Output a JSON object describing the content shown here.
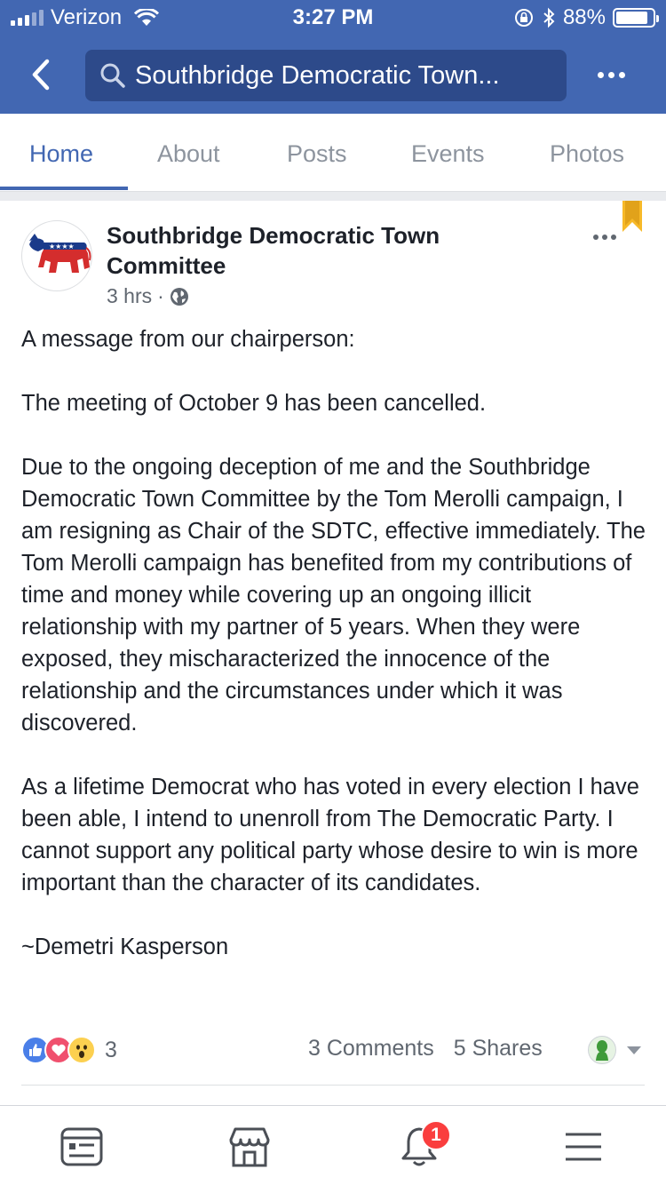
{
  "status_bar": {
    "carrier": "Verizon",
    "time": "3:27 PM",
    "battery": "88%",
    "battery_level": 0.88,
    "icons": [
      "signal-icon",
      "wifi-icon",
      "rotation-lock-icon",
      "bluetooth-icon",
      "battery-icon"
    ]
  },
  "header": {
    "search_text": "Southbridge Democratic Town...",
    "back_icon": "chevron-left-icon",
    "more_icon": "more-horizontal-icon"
  },
  "tabs": [
    {
      "label": "Home",
      "active": true
    },
    {
      "label": "About",
      "active": false
    },
    {
      "label": "Posts",
      "active": false
    },
    {
      "label": "Events",
      "active": false
    },
    {
      "label": "Photos",
      "active": false
    }
  ],
  "post": {
    "author": "Southbridge Democratic Town Committee",
    "time": "3 hrs",
    "visibility_icon": "globe-icon",
    "paragraphs": [
      "A message from our chairperson:",
      "The meeting of October 9 has been cancelled.",
      "Due to the ongoing deception of me and the Southbridge Democratic Town Committee by the Tom Merolli campaign, I am resigning as Chair of the SDTC, effective immediately. The Tom Merolli campaign has benefited from my contributions of time and money while covering up an ongoing illicit relationship with my partner of 5 years. When they were exposed, they mischaracterized the innocence of the relationship and the circumstances under which it was discovered.",
      "As a lifetime Democrat who has voted in every election I have been able, I intend to unenroll from The Democratic Party.  I cannot support any political party whose desire to win is more important than the character of its candidates.",
      "~Demetri Kasperson"
    ],
    "reactions": [
      "like-icon",
      "love-icon",
      "wow-icon"
    ],
    "reaction_count": "3",
    "comments": "3 Comments",
    "shares": "5 Shares"
  },
  "bottom_nav": {
    "items": [
      "news-feed-icon",
      "marketplace-icon",
      "notifications-icon",
      "menu-icon"
    ],
    "notification_badge": "1"
  },
  "colors": {
    "brand_blue": "#4267b2",
    "search_bg": "#2d4a8a",
    "badge_red": "#fa3e3e",
    "bookmark_gold": "#f7b928"
  }
}
